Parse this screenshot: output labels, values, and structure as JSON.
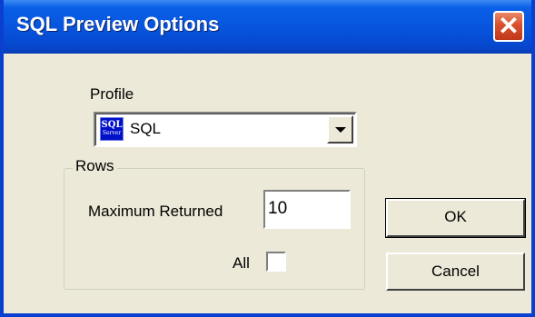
{
  "dialog": {
    "title": "SQL Preview Options",
    "close_glyph": "✕"
  },
  "profile": {
    "label": "Profile",
    "selected_value": "SQL",
    "icon": "sql-server-icon",
    "icon_text_top": "SQL",
    "icon_text_bottom": "Server"
  },
  "rows": {
    "group_label": "Rows",
    "max_returned_label": "Maximum Returned",
    "max_returned_value": "10",
    "all_label": "All",
    "all_checked": false
  },
  "buttons": {
    "ok_label": "OK",
    "cancel_label": "Cancel"
  },
  "colors": {
    "titlebar": "#0855dd",
    "face": "#ece9d8",
    "close": "#d8502c"
  }
}
